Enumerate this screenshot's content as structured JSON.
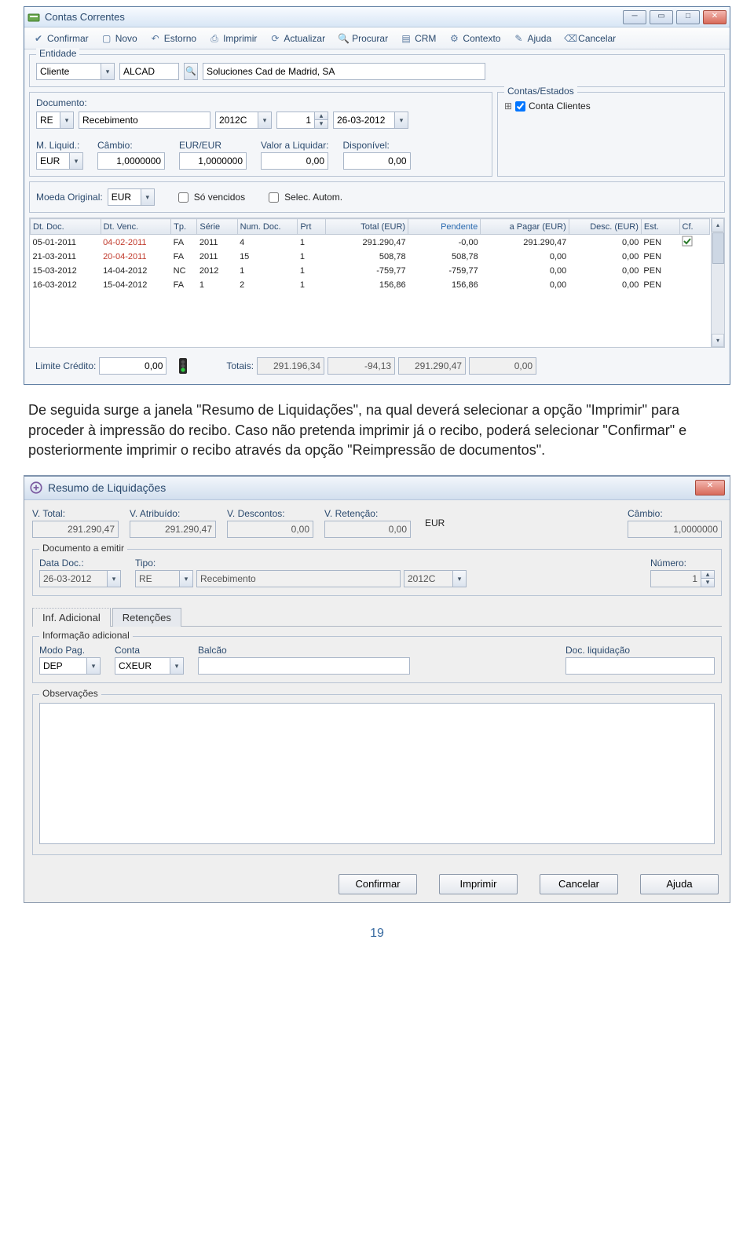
{
  "window1": {
    "title": "Contas Correntes",
    "toolbar": [
      {
        "id": "confirmar",
        "label": "Confirmar",
        "icon": "check"
      },
      {
        "id": "novo",
        "label": "Novo",
        "icon": "doc"
      },
      {
        "id": "estorno",
        "label": "Estorno",
        "icon": "undo"
      },
      {
        "id": "imprimir",
        "label": "Imprimir",
        "icon": "print"
      },
      {
        "id": "actualizar",
        "label": "Actualizar",
        "icon": "refresh"
      },
      {
        "id": "procurar",
        "label": "Procurar",
        "icon": "search"
      },
      {
        "id": "crm",
        "label": "CRM",
        "icon": "card"
      },
      {
        "id": "contexto",
        "label": "Contexto",
        "icon": "gear"
      },
      {
        "id": "ajuda",
        "label": "Ajuda",
        "icon": "help"
      },
      {
        "id": "cancelar",
        "label": "Cancelar",
        "icon": "cancel"
      }
    ],
    "entidade": {
      "legend": "Entidade",
      "tipo": "Cliente",
      "codigo": "ALCAD",
      "desc": "Soluciones Cad de Madrid, SA"
    },
    "documento": {
      "label": "Documento:",
      "tipo": "RE",
      "tipoDesc": "Recebimento",
      "serie": "2012C",
      "num": "1",
      "data": "26-03-2012"
    },
    "contas": {
      "legend": "Contas/Estados",
      "item": "Conta Clientes"
    },
    "liquid": {
      "mliq": "M. Liquid.:",
      "mliqVal": "EUR",
      "cambio": "Câmbio:",
      "cambioV": "1,0000000",
      "eurlabel": "EUR/EUR",
      "eurV": "1,0000000",
      "valLiq": "Valor a Liquidar:",
      "valLiqV": "0,00",
      "disp": "Disponível:",
      "dispV": "0,00"
    },
    "moeda": {
      "label": "Moeda Original:",
      "val": "EUR",
      "chk1": "Só vencidos",
      "chk2": "Selec. Autom."
    },
    "table": {
      "headers": [
        "Dt. Doc.",
        "Dt. Venc.",
        "Tp.",
        "Série",
        "Num. Doc.",
        "Prt",
        "Total (EUR)",
        "Pendente",
        "a Pagar (EUR)",
        "Desc. (EUR)",
        "Est.",
        "Cf."
      ],
      "rows": [
        {
          "dtDoc": "05-01-2011",
          "dtVenc": "04-02-2011",
          "tp": "FA",
          "serie": "2011",
          "num": "4",
          "prt": "1",
          "total": "291.290,47",
          "pend": "-0,00",
          "pagar": "291.290,47",
          "desc": "0,00",
          "est": "PEN",
          "cf": true,
          "vencRed": true
        },
        {
          "dtDoc": "21-03-2011",
          "dtVenc": "20-04-2011",
          "tp": "FA",
          "serie": "2011",
          "num": "15",
          "prt": "1",
          "total": "508,78",
          "pend": "508,78",
          "pagar": "0,00",
          "desc": "0,00",
          "est": "PEN",
          "cf": false,
          "vencRed": true
        },
        {
          "dtDoc": "15-03-2012",
          "dtVenc": "14-04-2012",
          "tp": "NC",
          "serie": "2012",
          "num": "1",
          "prt": "1",
          "total": "-759,77",
          "pend": "-759,77",
          "pagar": "0,00",
          "desc": "0,00",
          "est": "PEN",
          "cf": false,
          "vencRed": false
        },
        {
          "dtDoc": "16-03-2012",
          "dtVenc": "15-04-2012",
          "tp": "FA",
          "serie": "1",
          "num": "2",
          "prt": "1",
          "total": "156,86",
          "pend": "156,86",
          "pagar": "0,00",
          "desc": "0,00",
          "est": "PEN",
          "cf": false,
          "vencRed": false
        }
      ]
    },
    "totals": {
      "limite": "Limite Crédito:",
      "limiteV": "0,00",
      "totais": "Totais:",
      "t1": "291.196,34",
      "t2": "-94,13",
      "t3": "291.290,47",
      "t4": "0,00"
    }
  },
  "paragraph": "De seguida surge a janela \"Resumo de Liquidações\", na qual deverá selecionar a opção \"Imprimir\" para proceder à impressão do recibo. Caso não pretenda imprimir já o recibo, poderá selecionar \"Confirmar\" e posteriormente imprimir o recibo através da opção \"Reimpressão de documentos\".",
  "dialog": {
    "title": "Resumo de Liquidações",
    "vtotal": {
      "label": "V. Total:",
      "val": "291.290,47"
    },
    "vatr": {
      "label": "V. Atribuído:",
      "val": "291.290,47"
    },
    "vdesc": {
      "label": "V. Descontos:",
      "val": "0,00"
    },
    "vret": {
      "label": "V. Retenção:",
      "val": "0,00"
    },
    "moeda": "EUR",
    "cambio": {
      "label": "Câmbio:",
      "val": "1,0000000"
    },
    "docEmitir": {
      "legend": "Documento a emitir",
      "data": {
        "label": "Data Doc.:",
        "val": "26-03-2012"
      },
      "tipo": {
        "label": "Tipo:",
        "codigo": "RE",
        "desc": "Recebimento",
        "serie": "2012C"
      },
      "numero": {
        "label": "Número:",
        "val": "1"
      }
    },
    "tabs": {
      "t1": "Inf. Adicional",
      "t2": "Retenções"
    },
    "infoAdic": {
      "legend": "Informação adicional",
      "modo": {
        "label": "Modo Pag.",
        "val": "DEP"
      },
      "conta": {
        "label": "Conta",
        "val": "CXEUR"
      },
      "balcao": {
        "label": "Balcão",
        "val": ""
      },
      "docliq": {
        "label": "Doc. liquidação",
        "val": ""
      }
    },
    "obs": {
      "legend": "Observações",
      "val": ""
    },
    "buttons": {
      "confirmar": "Confirmar",
      "imprimir": "Imprimir",
      "cancelar": "Cancelar",
      "ajuda": "Ajuda"
    }
  },
  "pagenum": "19"
}
